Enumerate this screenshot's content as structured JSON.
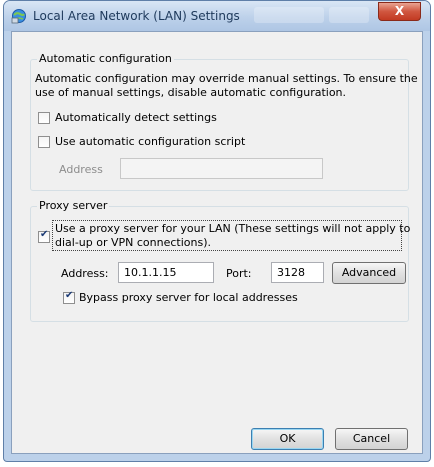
{
  "window": {
    "title": "Local Area Network (LAN) Settings",
    "close_label": "X"
  },
  "auto_config": {
    "legend": "Automatic configuration",
    "description_line1": "Automatic configuration may override manual settings.  To ensure the",
    "description_line2": "use of manual settings, disable automatic configuration.",
    "detect_label": "Automatically detect settings",
    "detect_checked": false,
    "script_label": "Use automatic configuration script",
    "script_checked": false,
    "address_label": "Address",
    "address_value": ""
  },
  "proxy": {
    "legend": "Proxy server",
    "use_proxy_line1": "Use a proxy server for your LAN (These settings will not apply to",
    "use_proxy_line2": "dial-up or VPN connections).",
    "use_proxy_checked": true,
    "address_label": "Address:",
    "address_value": "10.1.1.15",
    "port_label": "Port:",
    "port_value": "3128",
    "advanced_label": "Advanced",
    "bypass_label": "Bypass proxy server for local addresses",
    "bypass_checked": true
  },
  "buttons": {
    "ok_label": "OK",
    "cancel_label": "Cancel"
  },
  "colors": {
    "title_text": "#1e395b",
    "close_button": "#c23a22",
    "frame": "#bcd1ea"
  }
}
